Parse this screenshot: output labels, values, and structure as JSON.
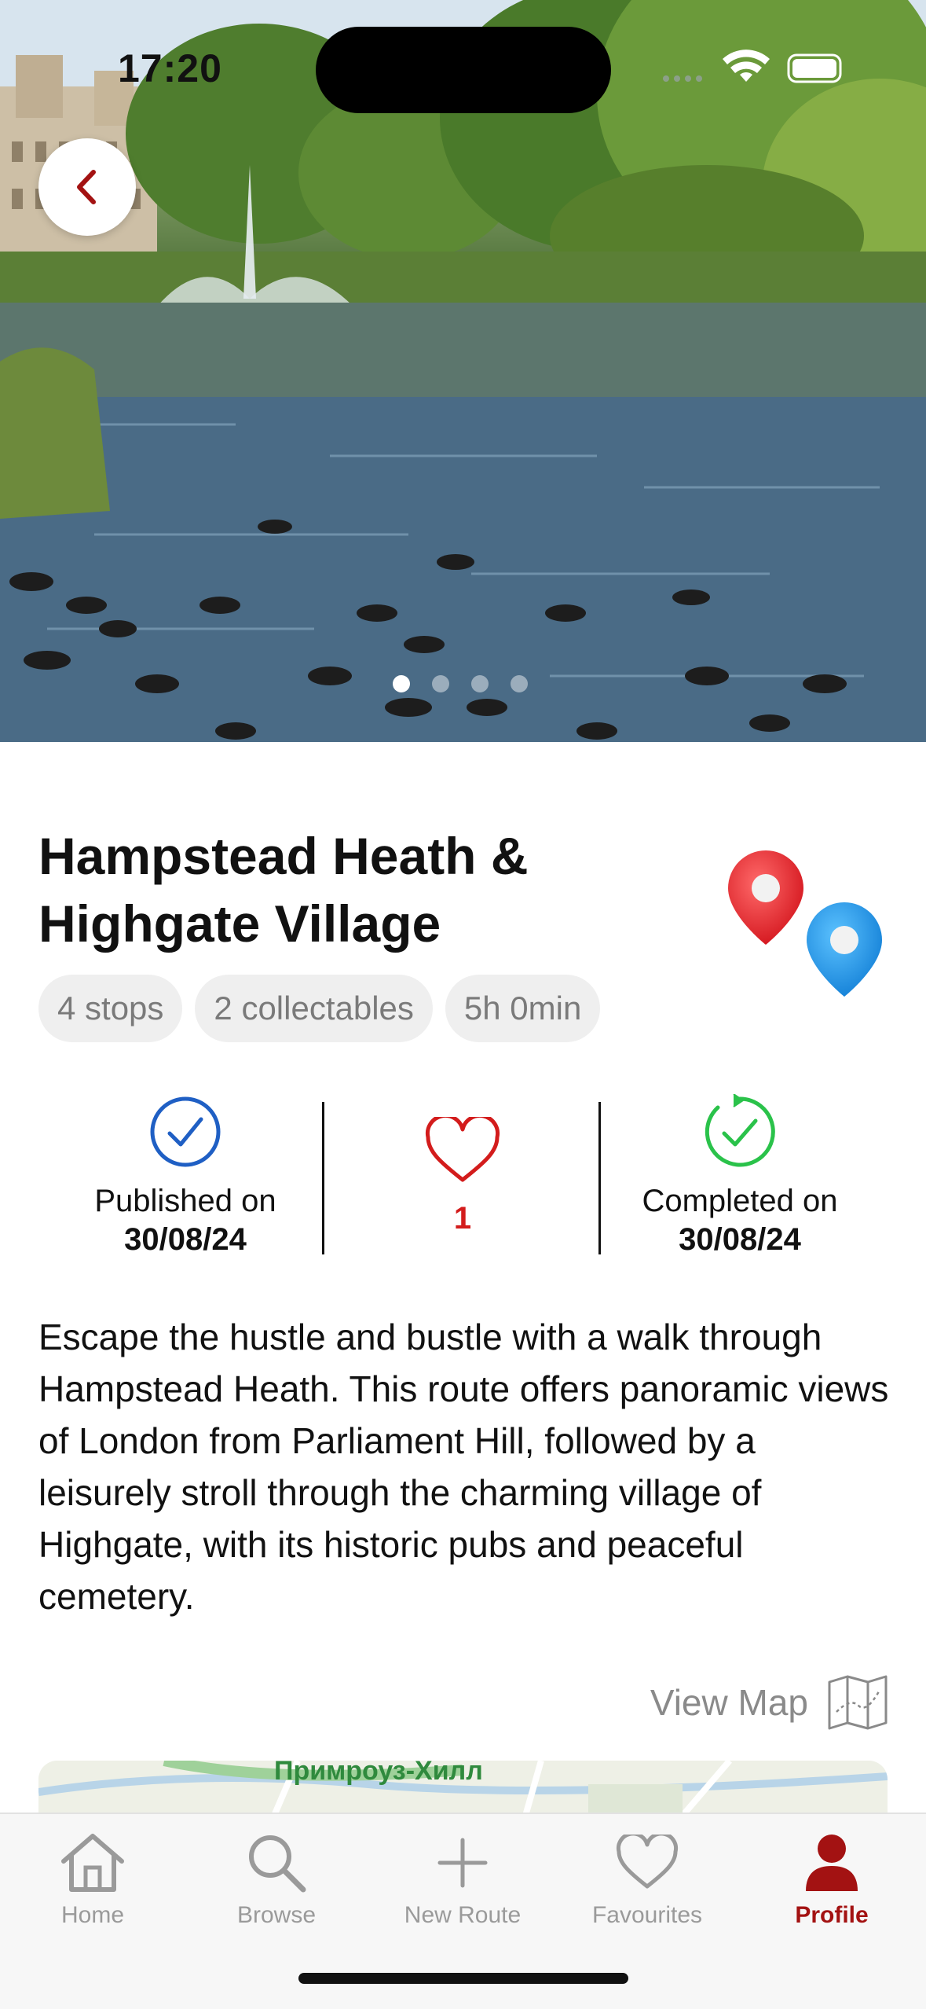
{
  "status_bar": {
    "time": "17:20"
  },
  "hero": {
    "image_description": "",
    "page_count": 4,
    "active_page": 1
  },
  "route": {
    "title": "Hampstead Heath & Highgate Village",
    "chips": [
      "4 stops",
      "2 collectables",
      "5h 0min"
    ],
    "published_label": "Published on",
    "published_date": "30/08/24",
    "likes": "1",
    "completed_label": "Completed on",
    "completed_date": "30/08/24",
    "description": "Escape the hustle and bustle with a walk through Hampstead Heath. This route offers panoramic views of London from Parliament Hill, followed by a leisurely stroll through the charming village of Highgate, with its historic pubs and peaceful cemetery.",
    "view_map_label": "View Map",
    "map_place_label": "Примроуз-Хилл"
  },
  "tabs": [
    {
      "label": "Home",
      "icon": "house-icon",
      "active": false
    },
    {
      "label": "Browse",
      "icon": "search-icon",
      "active": false
    },
    {
      "label": "New Route",
      "icon": "plus-icon",
      "active": false
    },
    {
      "label": "Favourites",
      "icon": "heart-icon",
      "active": false
    },
    {
      "label": "Profile",
      "icon": "person-icon",
      "active": true
    }
  ],
  "colors": {
    "accent": "#a31212",
    "like_red": "#d31c1c",
    "published_blue": "#1f5fc4",
    "completed_green": "#2ac24a"
  }
}
